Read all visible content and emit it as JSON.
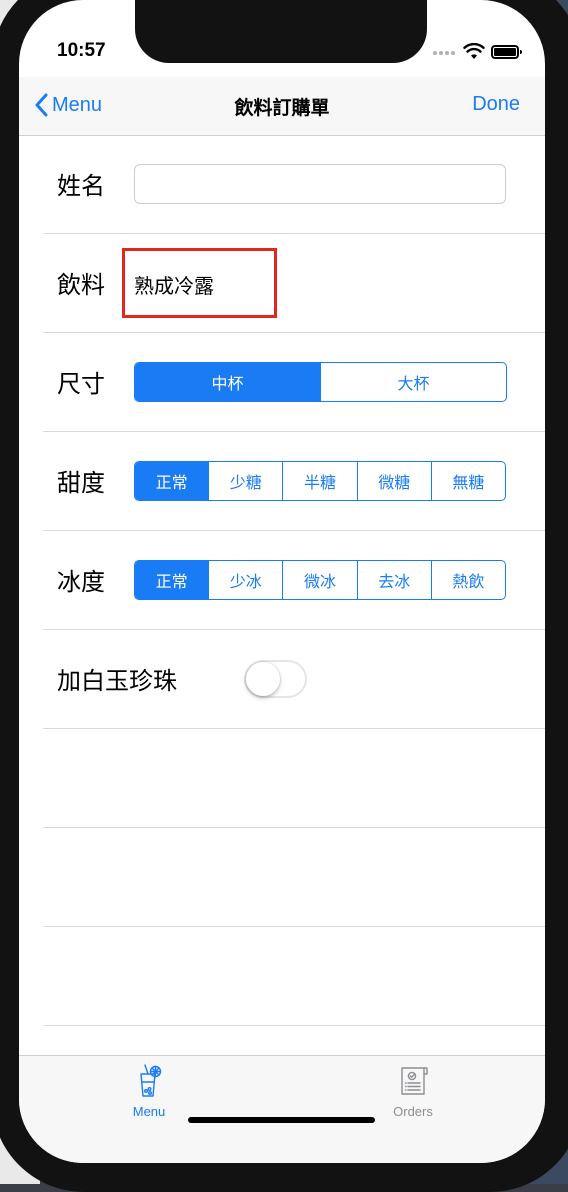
{
  "status_bar": {
    "time": "10:57"
  },
  "nav": {
    "back_label": "Menu",
    "title": "飲料訂購單",
    "done_label": "Done"
  },
  "form": {
    "name": {
      "label": "姓名",
      "value": "",
      "placeholder": ""
    },
    "drink": {
      "label": "飲料",
      "value": "熟成冷露"
    },
    "size": {
      "label": "尺寸",
      "options": [
        "中杯",
        "大杯"
      ],
      "selected": "中杯"
    },
    "sweetness": {
      "label": "甜度",
      "options": [
        "正常",
        "少糖",
        "半糖",
        "微糖",
        "無糖"
      ],
      "selected": "正常"
    },
    "ice": {
      "label": "冰度",
      "options": [
        "正常",
        "少冰",
        "微冰",
        "去冰",
        "熱飲"
      ],
      "selected": "正常"
    },
    "pearls": {
      "label": "加白玉珍珠",
      "enabled": false
    }
  },
  "tabbar": {
    "items": [
      {
        "label": "Menu",
        "icon": "drink-cup-icon",
        "selected": true
      },
      {
        "label": "Orders",
        "icon": "order-receipt-icon",
        "selected": false
      }
    ]
  },
  "colors": {
    "accent": "#1a7cf5",
    "highlight_box": "#e2281e",
    "separator": "#dadada"
  }
}
